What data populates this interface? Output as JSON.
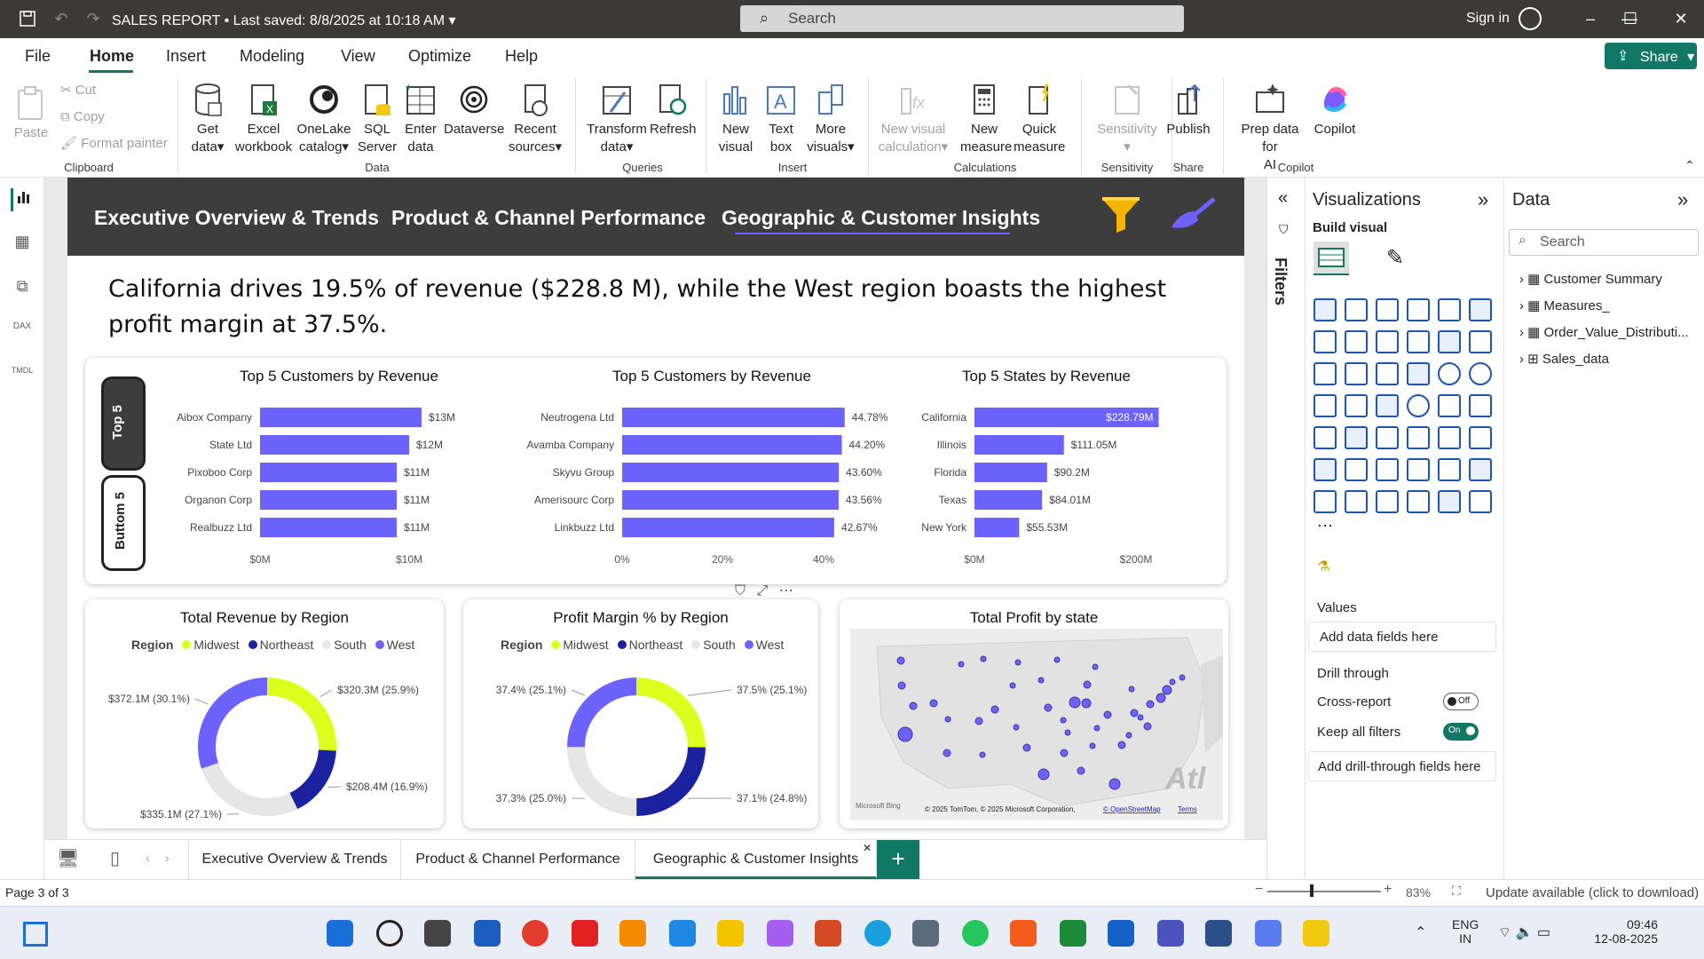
{
  "titlebar": {
    "doc_title": "SALES REPORT",
    "saved": "Last saved: 8/8/2025 at 10:18 AM",
    "search_placeholder": "Search",
    "signin": "Sign in"
  },
  "menu": {
    "items": [
      "File",
      "Home",
      "Insert",
      "Modeling",
      "View",
      "Optimize",
      "Help"
    ],
    "active": "Home",
    "share": "Share"
  },
  "ribbon": {
    "clipboard": {
      "paste": "Paste",
      "cut": "Cut",
      "copy": "Copy",
      "format_painter": "Format painter",
      "group": "Clipboard"
    },
    "data": {
      "get_data": [
        "Get",
        "data"
      ],
      "excel": [
        "Excel",
        "workbook"
      ],
      "onelake": [
        "OneLake",
        "catalog"
      ],
      "sql": [
        "SQL",
        "Server"
      ],
      "enter": [
        "Enter",
        "data"
      ],
      "dataverse": "Dataverse",
      "recent": [
        "Recent",
        "sources"
      ],
      "group": "Data"
    },
    "queries": {
      "transform": [
        "Transform",
        "data"
      ],
      "refresh": "Refresh",
      "group": "Queries"
    },
    "insert": {
      "new_visual": [
        "New",
        "visual"
      ],
      "text_box": [
        "Text",
        "box"
      ],
      "more_visuals": [
        "More",
        "visuals"
      ],
      "group": "Insert"
    },
    "calculations": {
      "new_visual_calc": [
        "New visual",
        "calculation"
      ],
      "new_measure": [
        "New",
        "measure"
      ],
      "quick_measure": [
        "Quick",
        "measure"
      ],
      "group": "Calculations"
    },
    "sensitivity": {
      "label": "Sensitivity",
      "group": "Sensitivity"
    },
    "share": {
      "publish": "Publish",
      "group": "Share"
    },
    "copilot": {
      "prep": [
        "Prep data for",
        "AI"
      ],
      "copilot": "Copilot",
      "group": "Copilot"
    }
  },
  "report": {
    "tabs": [
      "Executive Overview & Trends",
      "Product & Channel Performance",
      "Geographic & Customer Insights"
    ],
    "active_tab": "Geographic & Customer Insights",
    "insight": "California drives 19.5% of revenue ($228.8 M), while the West region boasts the highest profit margin at 37.5%.",
    "toggle": {
      "top": "Top 5",
      "bottom": "Buttom 5"
    }
  },
  "chart_data": [
    {
      "type": "bar",
      "title": "Top 5 Customers by Revenue",
      "categories": [
        "Aibox Company",
        "State Ltd",
        "Pixoboo Corp",
        "Organon Corp",
        "Realbuzz Ltd"
      ],
      "values": [
        13,
        12,
        11,
        11,
        11
      ],
      "data_labels": [
        "$13M",
        "$12M",
        "$11M",
        "$11M",
        "$11M"
      ],
      "x_ticks": [
        "$0M",
        "$10M"
      ],
      "xlim": [
        0,
        15
      ],
      "color": "#6c63ff"
    },
    {
      "type": "bar",
      "title": "Top 5 Customers by Revenue",
      "categories": [
        "Neutrogena Ltd",
        "Avamba Company",
        "Skyvu Group",
        "Amerisourc Corp",
        "Linkbuzz Ltd"
      ],
      "values": [
        44.78,
        44.2,
        43.6,
        43.56,
        42.67
      ],
      "data_labels": [
        "44.78%",
        "44.20%",
        "43.60%",
        "43.56%",
        "42.67%"
      ],
      "x_ticks": [
        "0%",
        "20%",
        "40%"
      ],
      "xlim": [
        0,
        50
      ],
      "color": "#6c63ff"
    },
    {
      "type": "bar",
      "title": "Top 5 States by Revenue",
      "categories": [
        "California",
        "Illinois",
        "Florida",
        "Texas",
        "New York"
      ],
      "values": [
        228.79,
        111.05,
        90.2,
        84.01,
        55.53
      ],
      "data_labels": [
        "$228.79M",
        "$111.05M",
        "$90.2M",
        "$84.01M",
        "$55.53M"
      ],
      "x_ticks": [
        "$0M",
        "$200M"
      ],
      "xlim": [
        0,
        280
      ],
      "color": "#6c63ff"
    },
    {
      "type": "pie",
      "title": "Total Revenue by Region",
      "legend_title": "Region",
      "categories": [
        "Midwest",
        "Northeast",
        "South",
        "West"
      ],
      "values": [
        320.3,
        208.4,
        335.1,
        372.1
      ],
      "data_labels": [
        "$320.3M (25.9%)",
        "$208.4M (16.9%)",
        "$335.1M (27.1%)",
        "$372.1M (30.1%)"
      ],
      "colors": [
        "#dcff1e",
        "#1a22a0",
        "#e6e6e6",
        "#6c63ff"
      ]
    },
    {
      "type": "pie",
      "title": "Profit Margin % by Region",
      "legend_title": "Region",
      "categories": [
        "Midwest",
        "Northeast",
        "South",
        "West"
      ],
      "values": [
        37.5,
        37.1,
        37.3,
        37.4
      ],
      "data_labels": [
        "37.5% (25.1%)",
        "37.1% (24.8%)",
        "37.3% (25.0%)",
        "37.4% (25.1%)"
      ],
      "colors": [
        "#dcff1e",
        "#1a22a0",
        "#e6e6e6",
        "#6c63ff"
      ]
    }
  ],
  "map": {
    "title": "Total Profit by state",
    "attribution": "© 2025 TomTom, © 2025 Microsoft Corporation,",
    "osm": "© OpenStreetMap",
    "terms": "Terms",
    "bing": "Microsoft Bing",
    "watermark": "Atl"
  },
  "filters_label": "Filters",
  "visualizations": {
    "title": "Visualizations",
    "build": "Build visual",
    "values": "Values",
    "add_fields": "Add data fields here",
    "drill": "Drill through",
    "cross_report": "Cross-report",
    "cross_state": "Off",
    "keep_filters": "Keep all filters",
    "keep_state": "On",
    "add_drill": "Add drill-through fields here"
  },
  "data_pane": {
    "title": "Data",
    "search": "Search",
    "tables": [
      "Customer Summary",
      "Measures_",
      "Order_Value_Distributi...",
      "Sales_data"
    ]
  },
  "page_tabs": [
    "Executive Overview & Trends",
    "Product & Channel Performance",
    "Geographic & Customer Insights"
  ],
  "status": {
    "page": "Page 3 of 3",
    "zoom": "83%",
    "update": "Update available (click to download)"
  },
  "taskbar": {
    "lang": "ENG",
    "region": "IN",
    "time": "09:46",
    "date": "12-08-2025"
  },
  "colors": {
    "accent": "#6c63ff",
    "nav_bg": "#3d3d3d",
    "brand": "#117865"
  }
}
